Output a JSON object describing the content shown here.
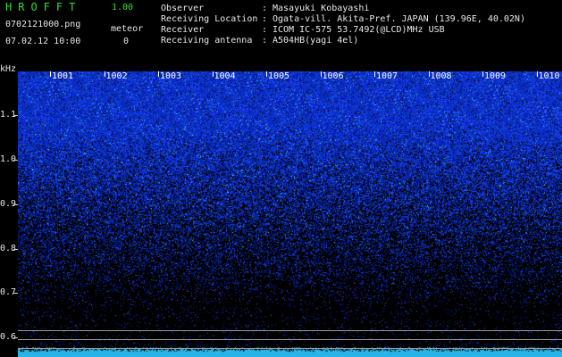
{
  "header": {
    "app_title": "HROFFT",
    "version": "1.00",
    "file_name": "0702121000.png",
    "meteor_label": "meteor",
    "timestamp": "07.02.12 10:00",
    "meteor_count": "0"
  },
  "info": [
    {
      "label": "Observer",
      "value": "Masayuki Kobayashi"
    },
    {
      "label": "Receiving Location",
      "value": "Ogata-vill. Akita-Pref. JAPAN (139.96E, 40.02N)"
    },
    {
      "label": "Receiver",
      "value": "ICOM IC-575 53.7492(@LCD)MHz USB"
    },
    {
      "label": "Receiving antenna",
      "value": "A504HB(yagi 4el)"
    }
  ],
  "axis": {
    "y_unit": "kHz",
    "y_ticks": [
      "1.1",
      "1.0",
      "0.9",
      "0.8",
      "0.7",
      "0.6"
    ],
    "x_ticks": [
      "1001",
      "1002",
      "1003",
      "1004",
      "1005",
      "1006",
      "1007",
      "1008",
      "1009",
      "1010"
    ]
  },
  "colors": {
    "background": "#000000",
    "title_green": "#33dd33",
    "text": "#e8e8e8",
    "noise_blue": "#1a3cff",
    "noise_cyan": "#33ccff"
  }
}
